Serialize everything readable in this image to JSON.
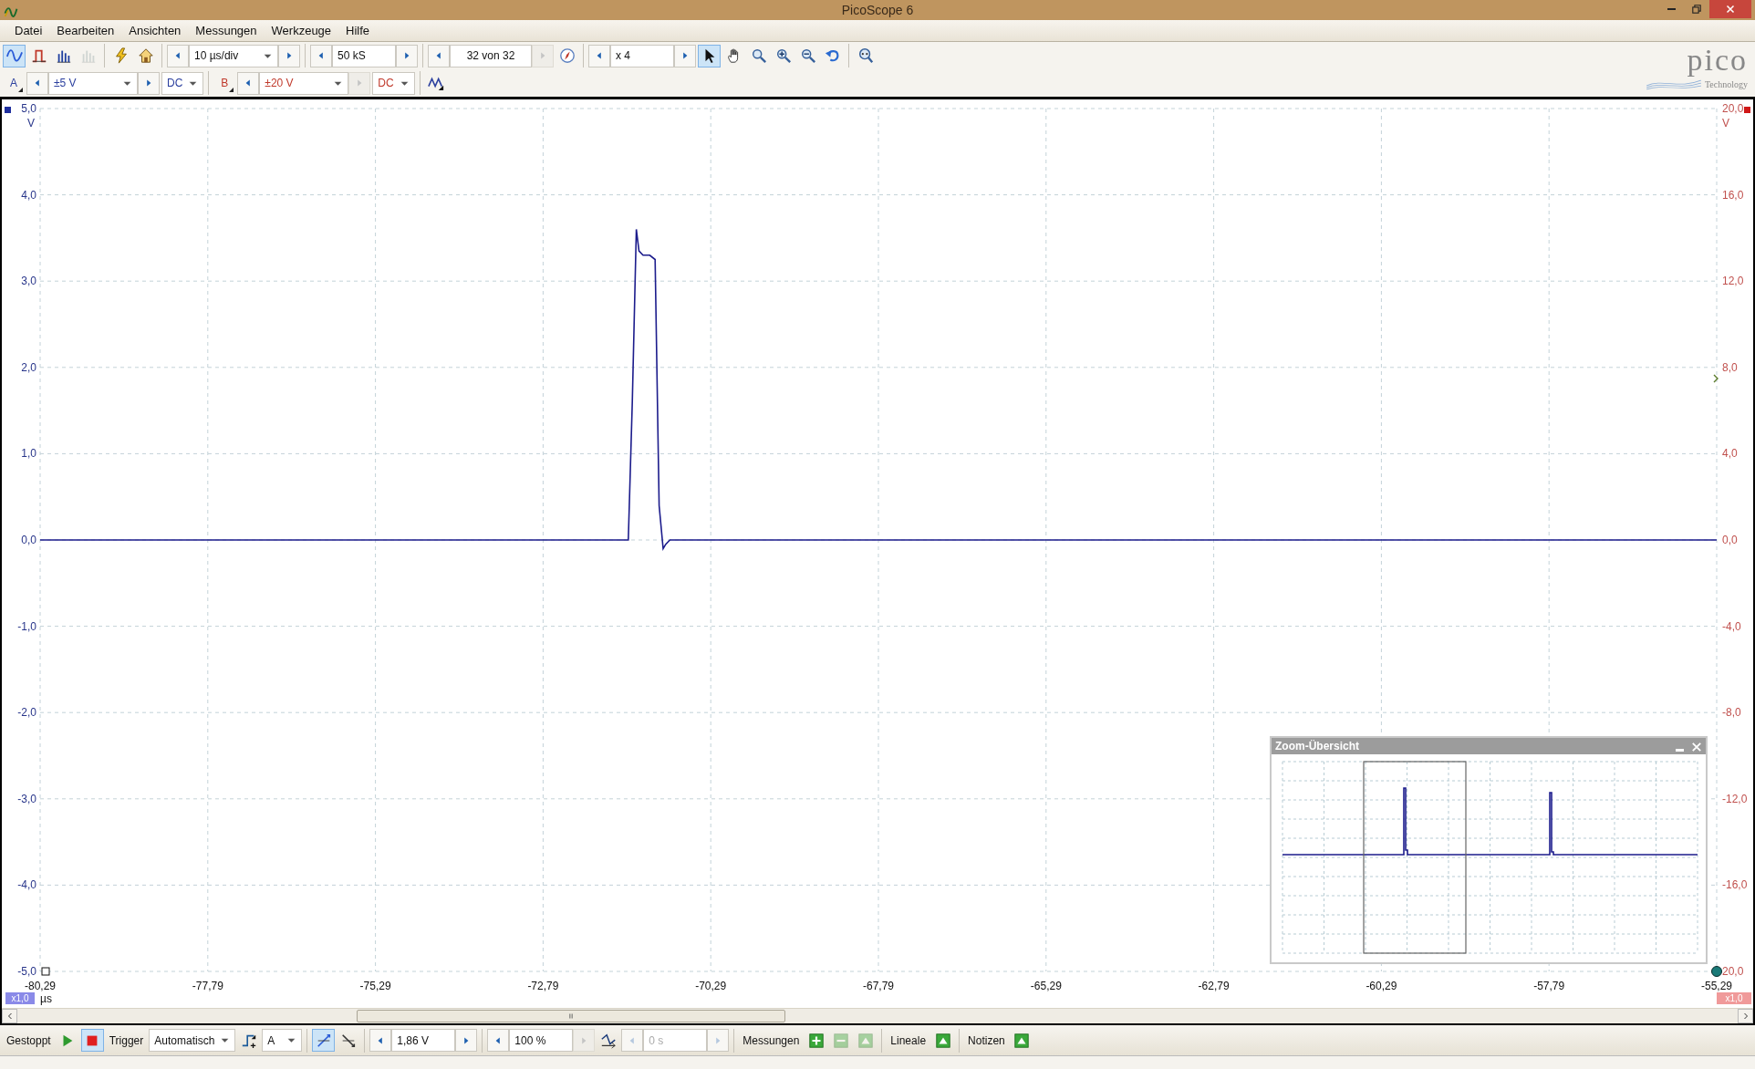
{
  "window": {
    "title": "PicoScope 6"
  },
  "menu": [
    "Datei",
    "Bearbeiten",
    "Ansichten",
    "Messungen",
    "Werkzeuge",
    "Hilfe"
  ],
  "toolbar_main": [
    {
      "kind": "icon",
      "selected": true,
      "disabled": false
    },
    {
      "kind": "icon",
      "selected": false,
      "disabled": false
    },
    {
      "kind": "icon",
      "selected": false,
      "disabled": false
    },
    {
      "kind": "icon",
      "selected": false,
      "disabled": true
    },
    {
      "kind": "sep"
    },
    {
      "kind": "icon",
      "selected": false,
      "disabled": false
    },
    {
      "kind": "icon",
      "selected": false,
      "disabled": false
    },
    {
      "kind": "sep"
    },
    {
      "kind": "spin",
      "value": "10 µs/div",
      "dropdown": true,
      "next_disabled": false,
      "disabled": false
    },
    {
      "kind": "sep"
    },
    {
      "kind": "spin",
      "value": "50 kS",
      "dropdown": false,
      "next_disabled": false,
      "disabled": false
    },
    {
      "kind": "sep"
    },
    {
      "kind": "spin",
      "value": "32 von 32",
      "dropdown": false,
      "next_disabled": true,
      "disabled": false
    },
    {
      "kind": "icon",
      "selected": false,
      "disabled": false
    },
    {
      "kind": "sep"
    },
    {
      "kind": "spin",
      "value": "x 4",
      "dropdown": false,
      "next_disabled": false,
      "disabled": false
    },
    {
      "kind": "icon",
      "selected": true,
      "disabled": false
    },
    {
      "kind": "icon",
      "selected": false,
      "disabled": false
    },
    {
      "kind": "icon",
      "selected": false,
      "disabled": false
    },
    {
      "kind": "icon",
      "selected": false,
      "disabled": false
    },
    {
      "kind": "icon",
      "selected": false,
      "disabled": false
    },
    {
      "kind": "icon",
      "selected": false,
      "disabled": false
    },
    {
      "kind": "sep"
    },
    {
      "kind": "icon",
      "selected": false,
      "disabled": false
    }
  ],
  "toolbar_channels": [
    {
      "kind": "channel",
      "label": "A",
      "color": "#2b3f9e"
    },
    {
      "kind": "spin",
      "value": "±5 V",
      "dropdown": true,
      "next_disabled": false,
      "disabled": false,
      "color": "#2b3f9e"
    },
    {
      "kind": "dropdown",
      "value": "DC",
      "color": "#2b3f9e"
    },
    {
      "kind": "sep"
    },
    {
      "kind": "channel",
      "label": "B",
      "color": "#c0392b"
    },
    {
      "kind": "spin",
      "value": "±20 V",
      "dropdown": true,
      "next_disabled": true,
      "disabled": false,
      "color": "#c0392b"
    },
    {
      "kind": "dropdown",
      "value": "DC",
      "color": "#c0392b"
    },
    {
      "kind": "sep"
    },
    {
      "kind": "icon",
      "selected": false,
      "disabled": false
    }
  ],
  "logo": {
    "name": "pico",
    "tagline": "Technology"
  },
  "scope": {
    "chart_data": {
      "type": "line",
      "x": [
        -80.29,
        -75.0,
        -72.0,
        -71.52,
        -71.46,
        -71.4,
        -71.36,
        -71.3,
        -71.2,
        -71.12,
        -71.06,
        -71.0,
        -70.96,
        -70.9,
        -65.0,
        -55.29
      ],
      "grid": true,
      "series": [
        {
          "color": "#1c1c8c",
          "values": [
            0,
            0,
            0,
            0,
            1.6,
            3.6,
            3.35,
            3.3,
            3.3,
            3.25,
            0.4,
            -0.1,
            -0.05,
            0,
            0,
            0
          ]
        }
      ],
      "xlim": [
        -80.29,
        -55.29
      ],
      "ylim": [
        -5,
        5
      ],
      "xticks": [
        {
          "value": -80.29,
          "label": "-80,29"
        },
        {
          "value": -77.79,
          "label": "-77,79"
        },
        {
          "value": -75.29,
          "label": "-75,29"
        },
        {
          "value": -72.79,
          "label": "-72,79"
        },
        {
          "value": -70.29,
          "label": "-70,29"
        },
        {
          "value": -67.79,
          "label": "-67,79"
        },
        {
          "value": -65.29,
          "label": "-65,29"
        },
        {
          "value": -62.79,
          "label": "-62,79"
        },
        {
          "value": -60.29,
          "label": "-60,29"
        },
        {
          "value": -57.79,
          "label": "-57,79"
        },
        {
          "value": -55.29,
          "label": "-55,29"
        }
      ],
      "yticks": [
        {
          "value": 5,
          "label": "5,0"
        },
        {
          "value": 4,
          "label": "4,0"
        },
        {
          "value": 3,
          "label": "3,0"
        },
        {
          "value": 2,
          "label": "2,0"
        },
        {
          "value": 1,
          "label": "1,0"
        },
        {
          "value": 0,
          "label": "0,0"
        },
        {
          "value": -1,
          "label": "-1,0"
        },
        {
          "value": -2,
          "label": "-2,0"
        },
        {
          "value": -3,
          "label": "-3,0"
        },
        {
          "value": -4,
          "label": "-4,0"
        },
        {
          "value": -5,
          "label": "-5,0"
        }
      ]
    },
    "channel_a_unit": "V",
    "channel_b_axis": {
      "unit": "V",
      "labels": [
        "20,0",
        "16,0",
        "12,0",
        "8,0",
        "4,0",
        "0,0",
        "-4,0",
        "-8,0",
        "-12,0",
        "-16,0",
        "20,0"
      ]
    },
    "time_unit": "µs",
    "scale_a": "x1,0",
    "scale_b": "x1,0"
  },
  "zoom_overview": {
    "title": "Zoom-Übersicht"
  },
  "status_bar": [
    {
      "kind": "label",
      "text": "Gestoppt"
    },
    {
      "kind": "icon",
      "selected": false,
      "disabled": false
    },
    {
      "kind": "icon",
      "selected": true,
      "disabled": false
    },
    {
      "kind": "label",
      "text": "Trigger"
    },
    {
      "kind": "dropdown",
      "value": "Automatisch"
    },
    {
      "kind": "icon",
      "selected": false,
      "disabled": false
    },
    {
      "kind": "dropdown",
      "value": "A"
    },
    {
      "kind": "sep"
    },
    {
      "kind": "icon",
      "selected": true,
      "disabled": false
    },
    {
      "kind": "icon",
      "selected": false,
      "disabled": false
    },
    {
      "kind": "sep"
    },
    {
      "kind": "spin",
      "value": "1,86 V",
      "dropdown": false,
      "next_disabled": false,
      "disabled": false
    },
    {
      "kind": "sep"
    },
    {
      "kind": "spin",
      "value": "100 %",
      "dropdown": false,
      "next_disabled": true,
      "disabled": false
    },
    {
      "kind": "icon",
      "selected": false,
      "disabled": false
    },
    {
      "kind": "spin",
      "value": "0 s",
      "dropdown": false,
      "next_disabled": false,
      "disabled": true
    },
    {
      "kind": "sep"
    },
    {
      "kind": "label",
      "text": "Messungen"
    },
    {
      "kind": "icon",
      "selected": false,
      "disabled": false
    },
    {
      "kind": "icon",
      "selected": false,
      "disabled": true
    },
    {
      "kind": "icon",
      "selected": false,
      "disabled": true
    },
    {
      "kind": "sep"
    },
    {
      "kind": "label",
      "text": "Lineale"
    },
    {
      "kind": "icon",
      "selected": false,
      "disabled": false
    },
    {
      "kind": "sep"
    },
    {
      "kind": "label",
      "text": "Notizen"
    },
    {
      "kind": "icon",
      "selected": false,
      "disabled": false
    }
  ]
}
